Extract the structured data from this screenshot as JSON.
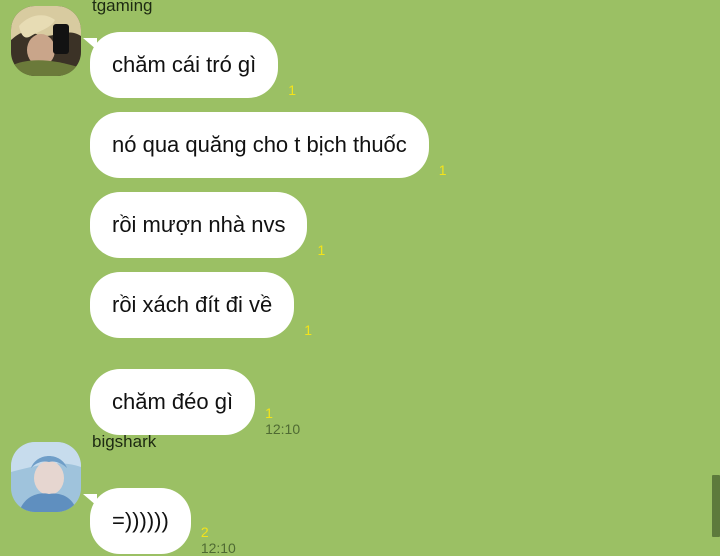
{
  "conversation": {
    "groups": [
      {
        "sender": "tgaming",
        "messages": [
          {
            "text": "chăm cái tró gì",
            "read": "1",
            "time": ""
          },
          {
            "text": "nó qua quăng cho t bịch thuốc",
            "read": "1",
            "time": ""
          },
          {
            "text": "rồi mượn nhà nvs",
            "read": "1",
            "time": ""
          },
          {
            "text": "rồi xách đít đi về",
            "read": "1",
            "time": ""
          },
          {
            "text": "chăm đéo gì",
            "read": "1",
            "time": "12:10"
          }
        ]
      },
      {
        "sender": "bigshark",
        "messages": [
          {
            "text": "=))))))",
            "read": "2",
            "time": "12:10"
          }
        ]
      }
    ]
  },
  "colors": {
    "background": "#9bc064",
    "bubble": "#ffffff",
    "read_count": "#f3e31a",
    "timestamp": "#4f6a33"
  }
}
